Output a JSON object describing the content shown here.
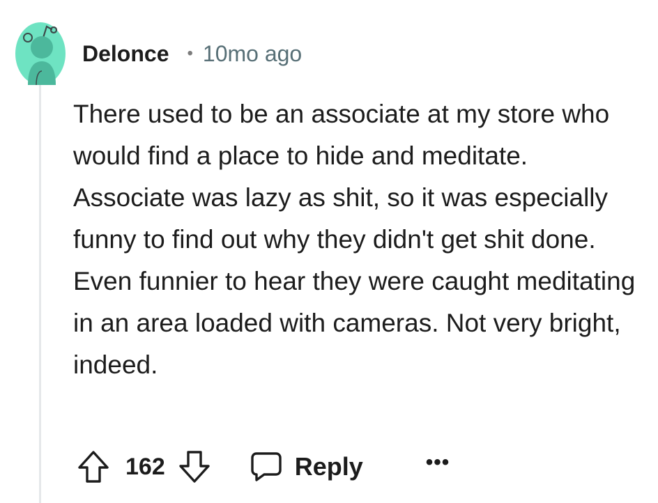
{
  "comment": {
    "author": "Delonce",
    "separator": "•",
    "timestamp": "10mo ago",
    "body": "There used to be an associate at my store who would find a place to hide and meditate. Associate was lazy as shit, so it was especially funny to find out why they didn't get shit done. Even funnier to hear they were caught meditating in an area loaded with cameras. Not very bright, indeed.",
    "avatar_color": "#6ee3c2"
  },
  "actions": {
    "upvote_icon": "arrow-up-icon",
    "vote_count": "162",
    "downvote_icon": "arrow-down-icon",
    "reply_icon": "speech-bubble-icon",
    "reply_label": "Reply",
    "more_label": "•••"
  }
}
